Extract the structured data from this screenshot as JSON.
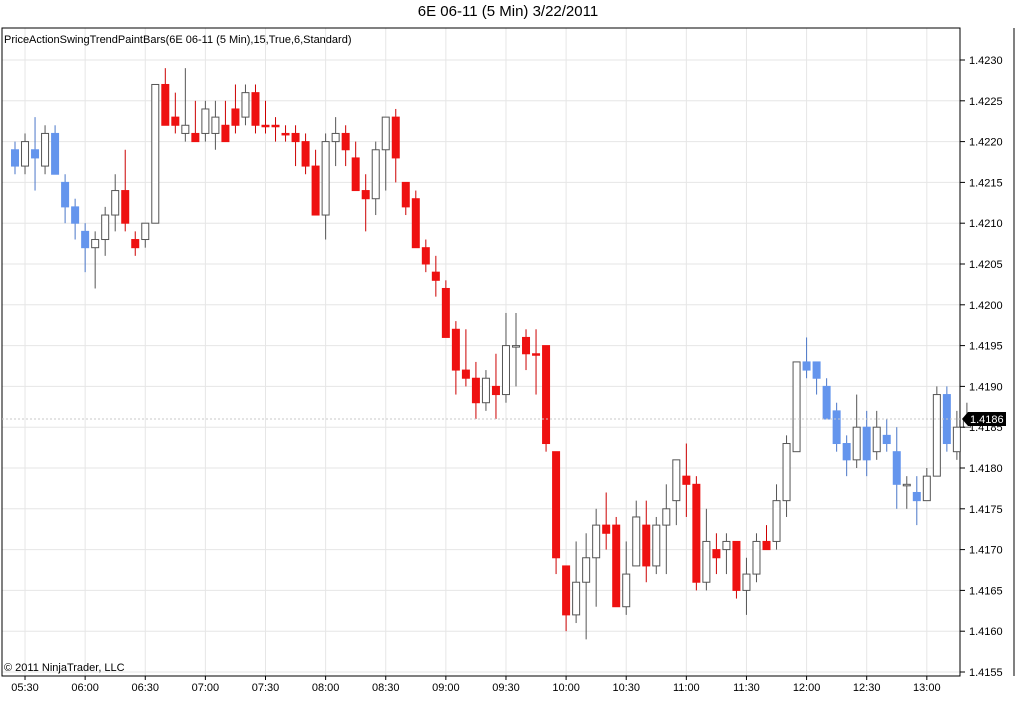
{
  "title": "6E 06-11 (5 Min)  3/22/2011",
  "indicator_label": "PriceActionSwingTrendPaintBars(6E 06-11 (5 Min),15,True,6,Standard)",
  "copyright": "© 2011 NinjaTrader, LLC",
  "last_price_label": "1.4186",
  "colors": {
    "down": "#ee1111",
    "up_trend": "#6495ed",
    "neutral_body": "#ffffff",
    "neutral_outline": "#555555",
    "red_wick": "#cc0000",
    "grid": "#e6e6e6",
    "axis": "#000000",
    "price_tag": "#000000"
  },
  "chart_data": {
    "type": "candlestick",
    "title": "6E 06-11 (5 Min)  3/22/2011",
    "interval_minutes": 5,
    "ylim": [
      1.4154,
      1.4233
    ],
    "y_ticks": [
      "1.4155",
      "1.4160",
      "1.4165",
      "1.4170",
      "1.4175",
      "1.4180",
      "1.4185",
      "1.4190",
      "1.4195",
      "1.4200",
      "1.4205",
      "1.4210",
      "1.4215",
      "1.4220",
      "1.4225",
      "1.4230"
    ],
    "x_ticks": [
      "05:30",
      "06:00",
      "06:30",
      "07:00",
      "07:30",
      "08:00",
      "08:30",
      "09:00",
      "09:30",
      "10:00",
      "10:30",
      "11:00",
      "11:30",
      "12:00",
      "12:30",
      "13:00"
    ],
    "grid": true,
    "last_price": 1.4186,
    "legend": "none",
    "bar_fields": [
      "open",
      "high",
      "low",
      "close",
      "paint"
    ],
    "bars": [
      [
        1.4219,
        1.422,
        1.4216,
        1.4217,
        "U"
      ],
      [
        1.4217,
        1.4221,
        1.4216,
        1.422,
        "N"
      ],
      [
        1.4219,
        1.4223,
        1.4214,
        1.4218,
        "U"
      ],
      [
        1.4217,
        1.4222,
        1.4216,
        1.4221,
        "N"
      ],
      [
        1.4221,
        1.4222,
        1.4216,
        1.4216,
        "U"
      ],
      [
        1.4215,
        1.4216,
        1.421,
        1.4212,
        "U"
      ],
      [
        1.4212,
        1.4213,
        1.4208,
        1.421,
        "U"
      ],
      [
        1.4209,
        1.421,
        1.4204,
        1.4207,
        "U"
      ],
      [
        1.4207,
        1.4209,
        1.4202,
        1.4208,
        "N"
      ],
      [
        1.4208,
        1.4212,
        1.4206,
        1.4211,
        "N"
      ],
      [
        1.4211,
        1.4216,
        1.4209,
        1.4214,
        "N"
      ],
      [
        1.4214,
        1.4219,
        1.4209,
        1.421,
        "D"
      ],
      [
        1.4208,
        1.4209,
        1.4206,
        1.4207,
        "D"
      ],
      [
        1.4208,
        1.421,
        1.4207,
        1.421,
        "N"
      ],
      [
        1.421,
        1.4227,
        1.421,
        1.4227,
        "N"
      ],
      [
        1.4227,
        1.4229,
        1.4222,
        1.4222,
        "D"
      ],
      [
        1.4223,
        1.4226,
        1.4221,
        1.4222,
        "D"
      ],
      [
        1.4222,
        1.4229,
        1.422,
        1.4221,
        "N"
      ],
      [
        1.4221,
        1.4225,
        1.4221,
        1.422,
        "D"
      ],
      [
        1.4221,
        1.4225,
        1.422,
        1.4224,
        "N"
      ],
      [
        1.4223,
        1.4225,
        1.4219,
        1.4221,
        "N"
      ],
      [
        1.4222,
        1.4225,
        1.422,
        1.422,
        "D"
      ],
      [
        1.4222,
        1.4227,
        1.4221,
        1.4224,
        "D"
      ],
      [
        1.4223,
        1.4227,
        1.4222,
        1.4226,
        "N"
      ],
      [
        1.4226,
        1.4227,
        1.4221,
        1.4222,
        "D"
      ],
      [
        1.4222,
        1.4225,
        1.4221,
        1.4222,
        "D"
      ],
      [
        1.4222,
        1.4223,
        1.422,
        1.4222,
        "D"
      ],
      [
        1.4221,
        1.4222,
        1.422,
        1.4221,
        "D"
      ],
      [
        1.4221,
        1.4222,
        1.4217,
        1.422,
        "D"
      ],
      [
        1.422,
        1.4221,
        1.4216,
        1.4217,
        "D"
      ],
      [
        1.4217,
        1.4219,
        1.4211,
        1.4211,
        "D"
      ],
      [
        1.4211,
        1.4221,
        1.4208,
        1.422,
        "N"
      ],
      [
        1.422,
        1.4223,
        1.4217,
        1.4221,
        "N"
      ],
      [
        1.4221,
        1.4222,
        1.4217,
        1.4219,
        "D"
      ],
      [
        1.4218,
        1.422,
        1.4214,
        1.4214,
        "D"
      ],
      [
        1.4214,
        1.4216,
        1.4209,
        1.4213,
        "D"
      ],
      [
        1.4213,
        1.422,
        1.4211,
        1.4219,
        "N"
      ],
      [
        1.4219,
        1.4223,
        1.4214,
        1.4223,
        "N"
      ],
      [
        1.4223,
        1.4224,
        1.4215,
        1.4218,
        "D"
      ],
      [
        1.4215,
        1.4215,
        1.4211,
        1.4212,
        "D"
      ],
      [
        1.4213,
        1.4214,
        1.4207,
        1.4207,
        "D"
      ],
      [
        1.4207,
        1.4208,
        1.4204,
        1.4205,
        "D"
      ],
      [
        1.4204,
        1.4206,
        1.4201,
        1.4203,
        "D"
      ],
      [
        1.4202,
        1.4203,
        1.4196,
        1.4196,
        "D"
      ],
      [
        1.4197,
        1.4198,
        1.4189,
        1.4192,
        "D"
      ],
      [
        1.4192,
        1.4197,
        1.419,
        1.4191,
        "D"
      ],
      [
        1.4191,
        1.4193,
        1.4186,
        1.4188,
        "D"
      ],
      [
        1.4188,
        1.4192,
        1.4187,
        1.4191,
        "N"
      ],
      [
        1.419,
        1.4194,
        1.4186,
        1.4189,
        "D"
      ],
      [
        1.4189,
        1.4199,
        1.4188,
        1.4195,
        "N"
      ],
      [
        1.4195,
        1.4199,
        1.419,
        1.4195,
        "N"
      ],
      [
        1.4196,
        1.4197,
        1.4192,
        1.4194,
        "D"
      ],
      [
        1.4194,
        1.4197,
        1.4189,
        1.4194,
        "D"
      ],
      [
        1.4195,
        1.4195,
        1.4182,
        1.4183,
        "D"
      ],
      [
        1.4182,
        1.4182,
        1.4167,
        1.4169,
        "D"
      ],
      [
        1.4168,
        1.4168,
        1.416,
        1.4162,
        "D"
      ],
      [
        1.4162,
        1.4171,
        1.4161,
        1.4166,
        "N"
      ],
      [
        1.4166,
        1.4172,
        1.4159,
        1.4169,
        "N"
      ],
      [
        1.4169,
        1.4175,
        1.4163,
        1.4173,
        "N"
      ],
      [
        1.4173,
        1.4177,
        1.417,
        1.4172,
        "D"
      ],
      [
        1.4173,
        1.4174,
        1.4163,
        1.4163,
        "D"
      ],
      [
        1.4163,
        1.4171,
        1.4162,
        1.4167,
        "N"
      ],
      [
        1.4168,
        1.4176,
        1.4168,
        1.4174,
        "N"
      ],
      [
        1.4173,
        1.4176,
        1.4166,
        1.4168,
        "D"
      ],
      [
        1.4168,
        1.4174,
        1.4167,
        1.4173,
        "N"
      ],
      [
        1.4173,
        1.4178,
        1.4167,
        1.4175,
        "N"
      ],
      [
        1.4176,
        1.4181,
        1.4173,
        1.4181,
        "N"
      ],
      [
        1.4179,
        1.4183,
        1.4174,
        1.4178,
        "D"
      ],
      [
        1.4178,
        1.4179,
        1.4165,
        1.4166,
        "D"
      ],
      [
        1.4166,
        1.4175,
        1.4165,
        1.4171,
        "N"
      ],
      [
        1.417,
        1.4172,
        1.4167,
        1.4169,
        "D"
      ],
      [
        1.417,
        1.4172,
        1.4167,
        1.4171,
        "N"
      ],
      [
        1.4171,
        1.4171,
        1.4164,
        1.4165,
        "D"
      ],
      [
        1.4165,
        1.4169,
        1.4162,
        1.4167,
        "N"
      ],
      [
        1.4167,
        1.4172,
        1.4166,
        1.4171,
        "N"
      ],
      [
        1.4171,
        1.4173,
        1.417,
        1.417,
        "D"
      ],
      [
        1.4171,
        1.4178,
        1.417,
        1.4176,
        "N"
      ],
      [
        1.4176,
        1.4184,
        1.4174,
        1.4183,
        "N"
      ],
      [
        1.4182,
        1.4193,
        1.4182,
        1.4193,
        "N"
      ],
      [
        1.4193,
        1.4196,
        1.4191,
        1.4192,
        "U"
      ],
      [
        1.4193,
        1.4193,
        1.4189,
        1.4191,
        "U"
      ],
      [
        1.419,
        1.4191,
        1.4186,
        1.4186,
        "U"
      ],
      [
        1.4187,
        1.4188,
        1.4182,
        1.4183,
        "U"
      ],
      [
        1.4183,
        1.4184,
        1.4179,
        1.4181,
        "U"
      ],
      [
        1.4181,
        1.4189,
        1.418,
        1.4185,
        "N"
      ],
      [
        1.4185,
        1.4187,
        1.4179,
        1.4181,
        "U"
      ],
      [
        1.4182,
        1.4187,
        1.4181,
        1.4185,
        "N"
      ],
      [
        1.4184,
        1.4186,
        1.4182,
        1.4183,
        "U"
      ],
      [
        1.4182,
        1.4185,
        1.4175,
        1.4178,
        "U"
      ],
      [
        1.4178,
        1.4179,
        1.4175,
        1.4178,
        "N"
      ],
      [
        1.4177,
        1.4179,
        1.4173,
        1.4176,
        "U"
      ],
      [
        1.4176,
        1.418,
        1.4176,
        1.4179,
        "N"
      ],
      [
        1.4179,
        1.419,
        1.4179,
        1.4189,
        "N"
      ],
      [
        1.4189,
        1.419,
        1.4182,
        1.4183,
        "U"
      ],
      [
        1.4182,
        1.4187,
        1.4181,
        1.4185,
        "N"
      ],
      [
        1.4185,
        1.4188,
        1.4185,
        1.4186,
        "N"
      ]
    ]
  }
}
